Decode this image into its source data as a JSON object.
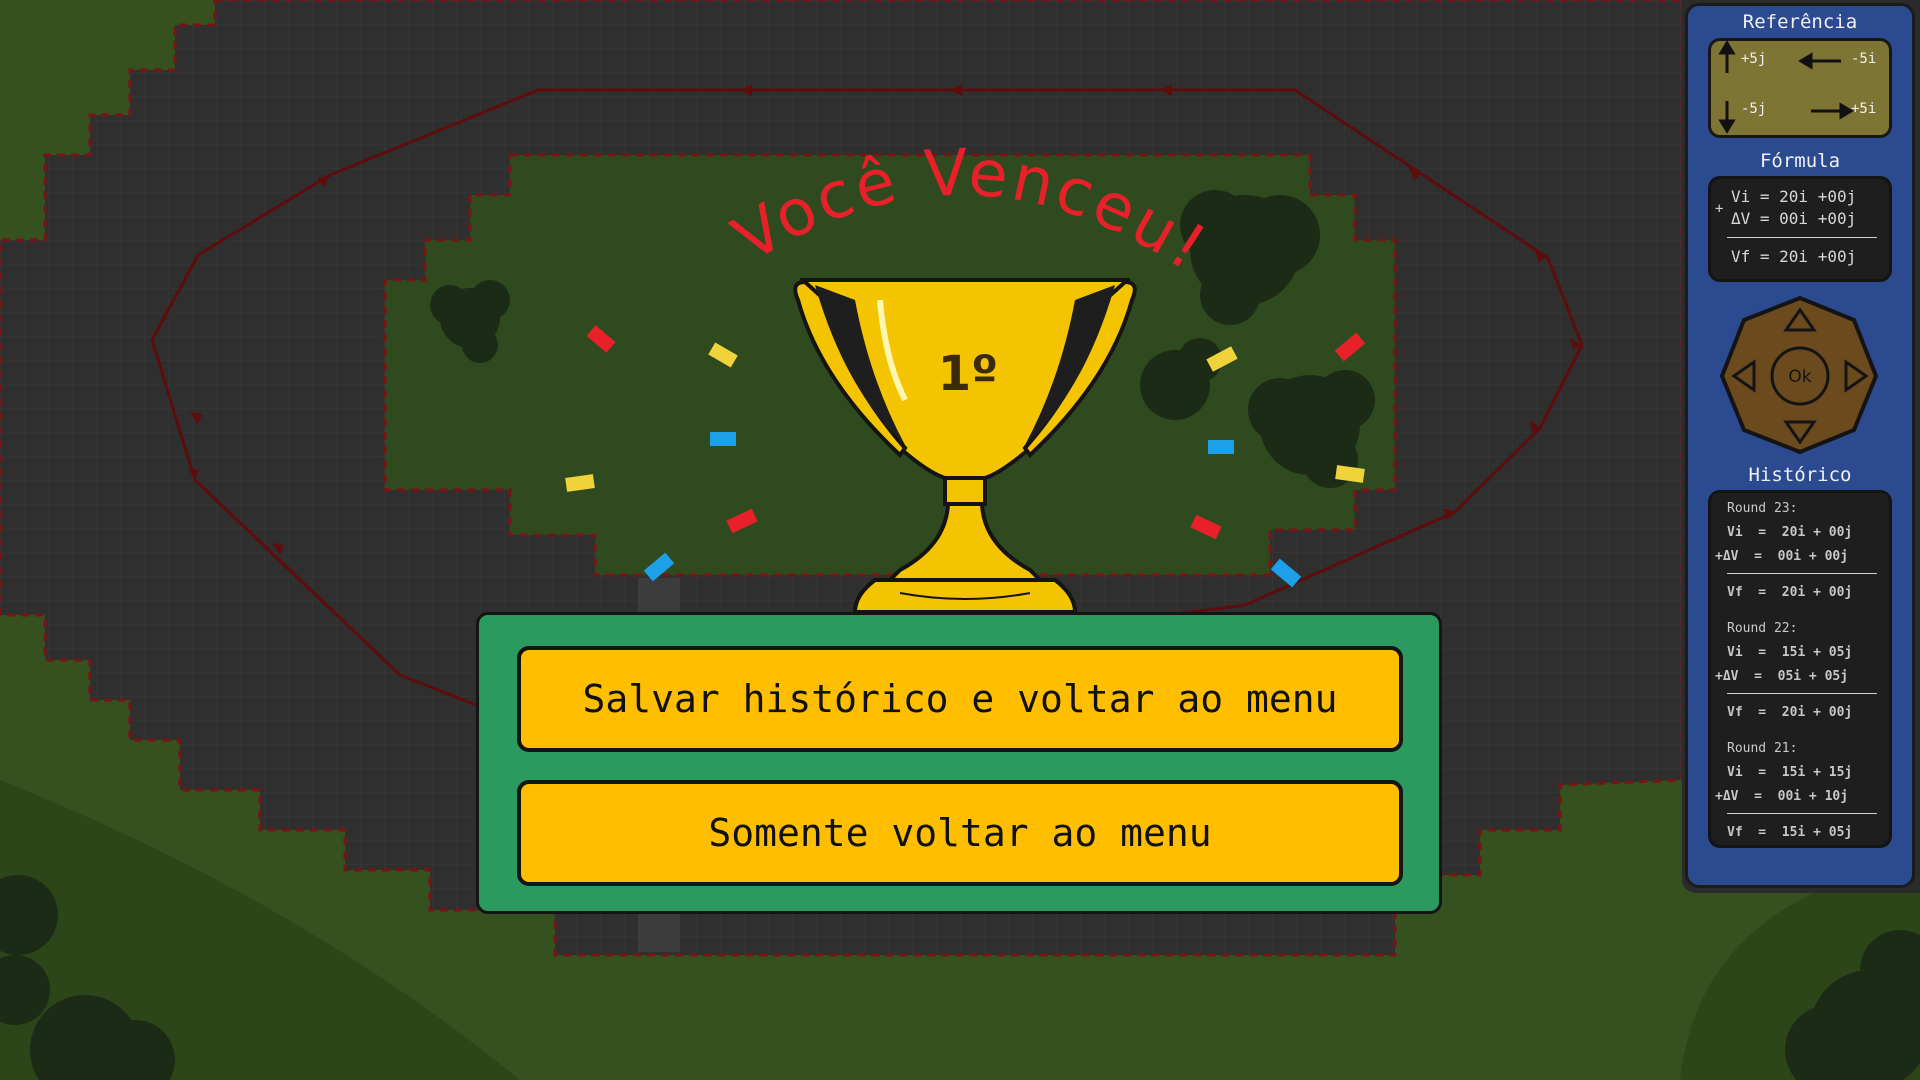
{
  "overlay": {
    "title": "Você Venceu!",
    "trophy_label": "1º"
  },
  "modal": {
    "save_button": "Salvar histórico e voltar ao menu",
    "menu_button": "Somente voltar ao menu"
  },
  "sidebar": {
    "reference_title": "Referência",
    "reference": {
      "up": "+5j",
      "left": "-5i",
      "down": "-5j",
      "right": "+5i"
    },
    "formula_title": "Fórmula",
    "formula": {
      "plus": "+",
      "vi": "Vi = 20i +00j",
      "dv": "ΔV = 00i +00j",
      "vf": "Vf = 20i +00j"
    },
    "dpad_ok": "Ok",
    "history_title": "Histórico",
    "history": [
      {
        "round": "Round 23:",
        "vi": "Vi  =  20i + 00j",
        "dv": "+ΔV  =  00i + 00j",
        "vf": "Vf  =  20i + 00j"
      },
      {
        "round": "Round 22:",
        "vi": "Vi  =  15i + 05j",
        "dv": "+ΔV  =  05i + 05j",
        "vf": "Vf  =  20i + 00j"
      },
      {
        "round": "Round 21:",
        "vi": "Vi  =  15i + 15j",
        "dv": "+ΔV  =  00i + 10j",
        "vf": "Vf  =  15i + 05j"
      }
    ]
  },
  "colors": {
    "grass": "#34511f",
    "track": "#2e2e2e",
    "infield": "#2f4a1e",
    "title_red": "#e8202a",
    "trophy_gold": "#f5c400",
    "button": "#ffbf00",
    "modal_green": "#2a9a5e",
    "sidebar_blue": "#2b4a8f"
  }
}
